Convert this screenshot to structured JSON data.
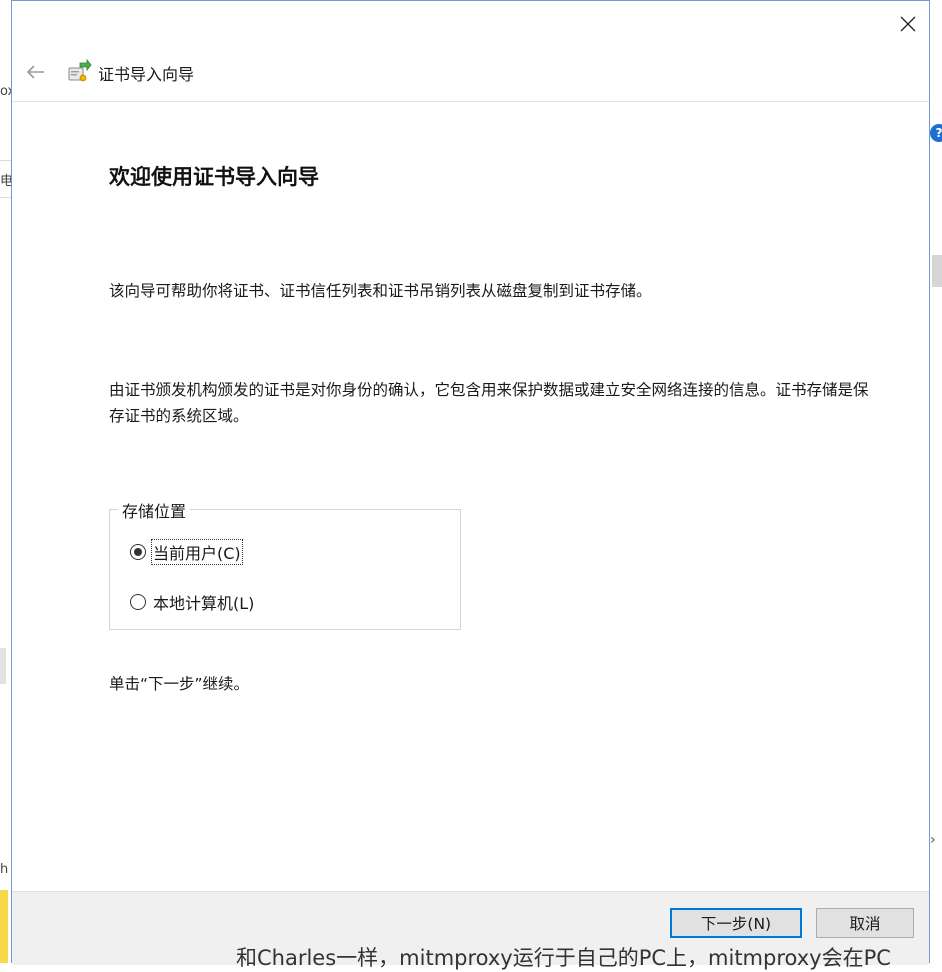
{
  "background": {
    "left_fragments": [
      "ox",
      "电",
      "h"
    ],
    "right_help_label": "?",
    "right_arrow": "›",
    "bottom_text": "和Charles一样，mitmproxy运行于自己的PC上，mitmproxy会在PC"
  },
  "dialog": {
    "title": "证书导入向导",
    "welcome_heading": "欢迎使用证书导入向导",
    "paragraph1": "该向导可帮助你将证书、证书信任列表和证书吊销列表从磁盘复制到证书存储。",
    "paragraph2": "由证书颁发机构颁发的证书是对你身份的确认，它包含用来保护数据或建立安全网络连接的信息。证书存储是保存证书的系统区域。",
    "store_location": {
      "label": "存储位置",
      "options": [
        {
          "label": "当前用户(C)",
          "selected": true
        },
        {
          "label": "本地计算机(L)",
          "selected": false
        }
      ]
    },
    "hint": "单击“下一步”继续。",
    "buttons": {
      "next": "下一步(N)",
      "cancel": "取消"
    }
  },
  "colors": {
    "primary_button_border": "#0078d7",
    "dialog_border": "#6f9bd1",
    "footer_bg": "#f0f0f0"
  }
}
